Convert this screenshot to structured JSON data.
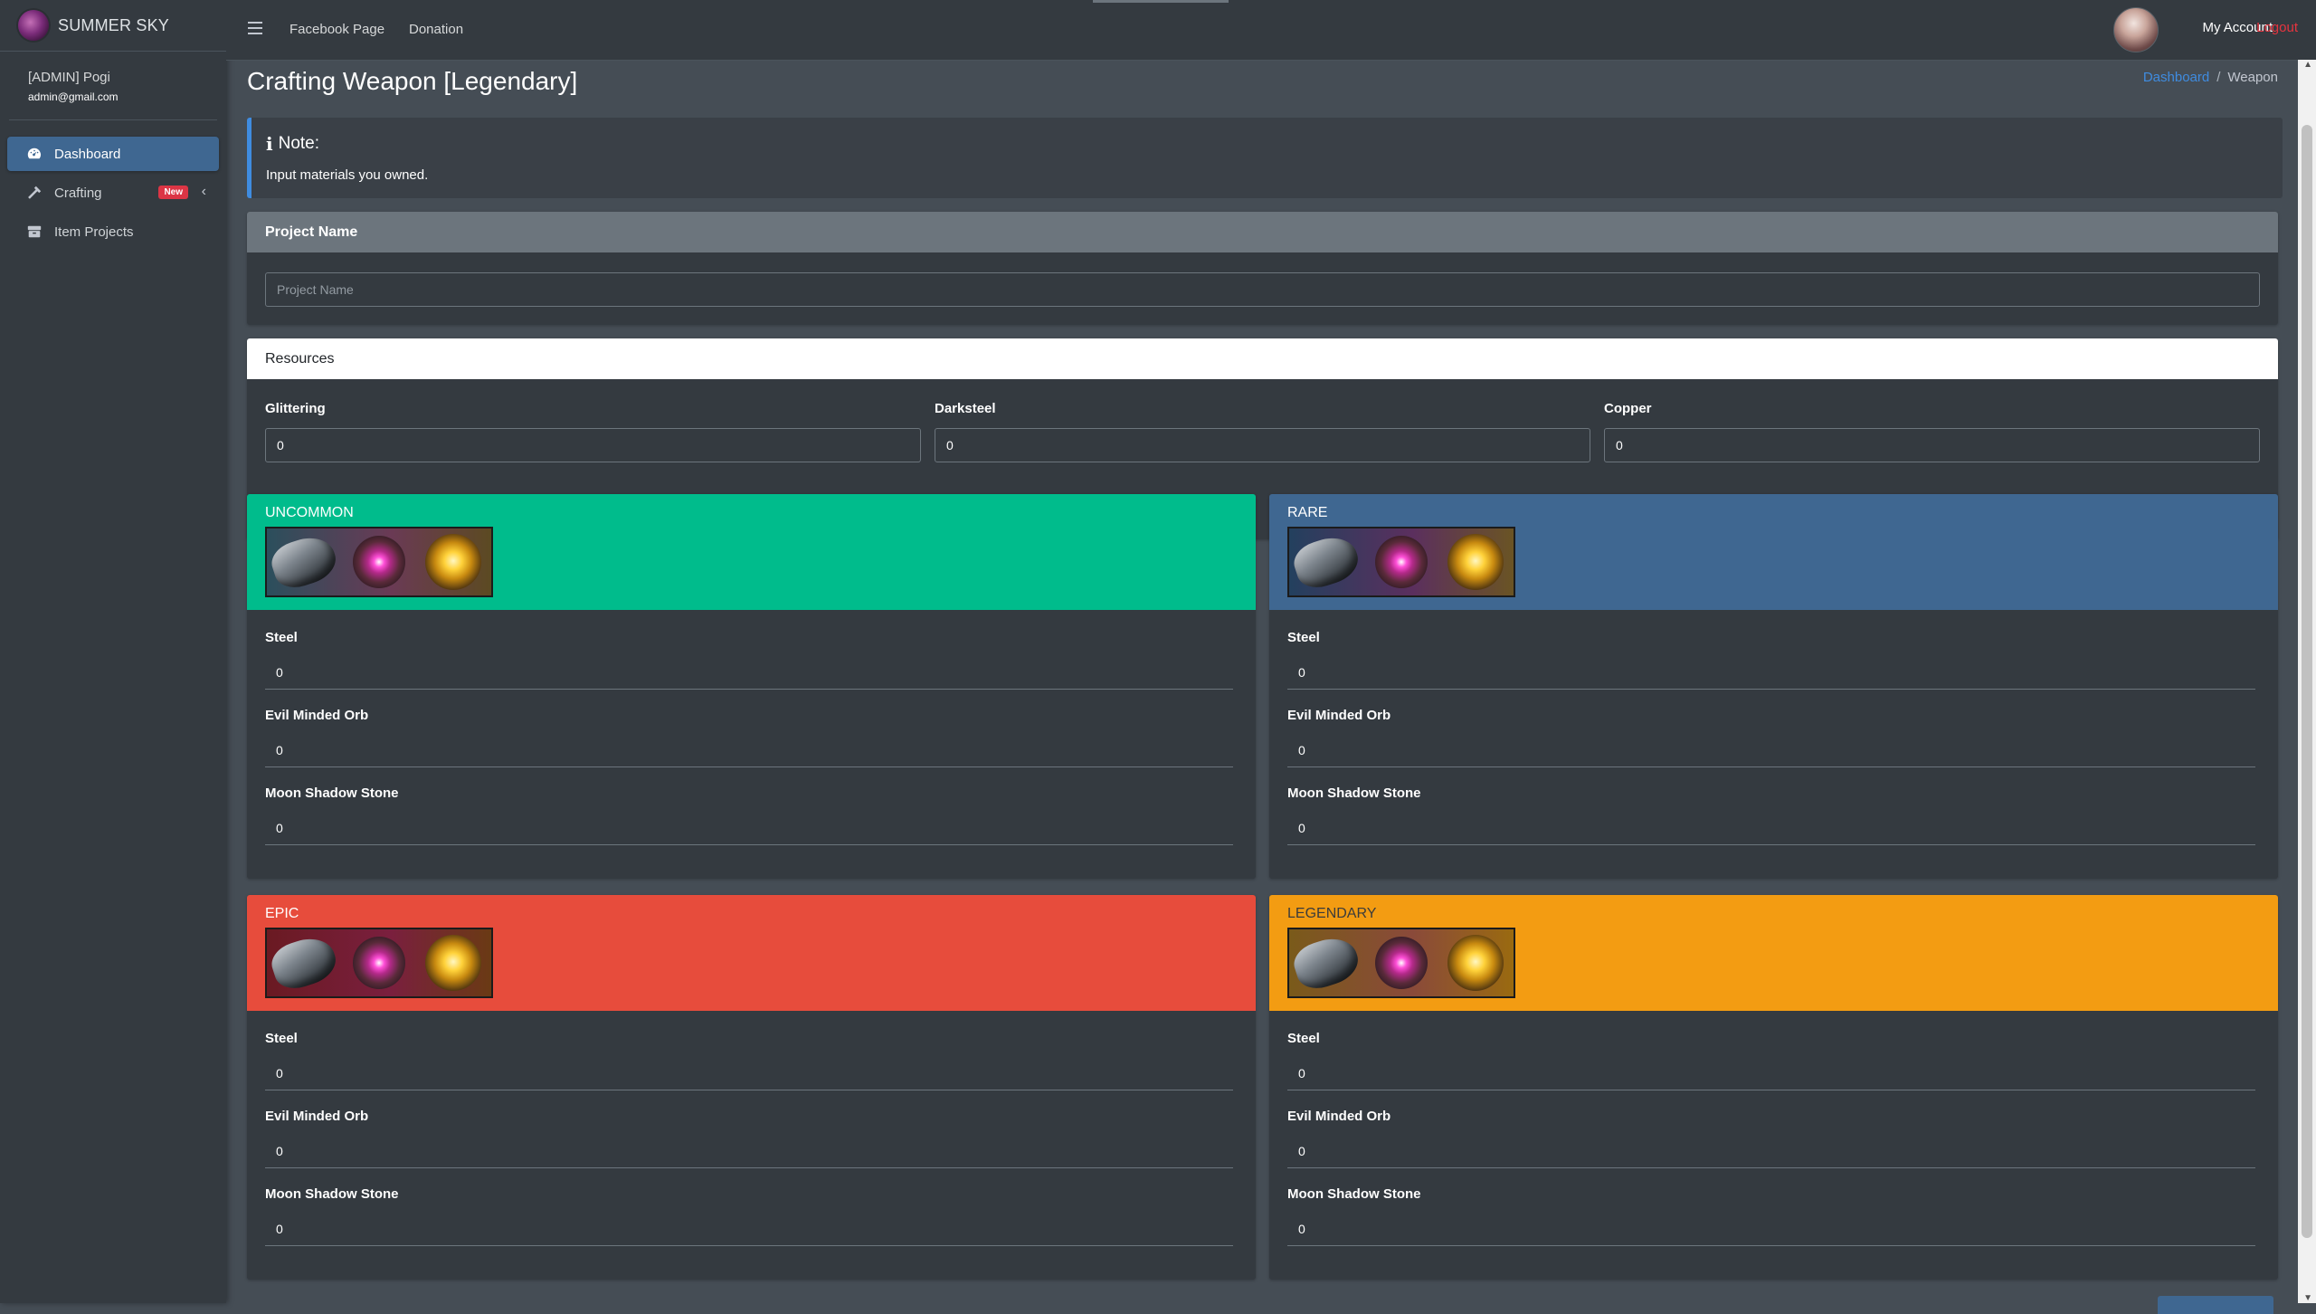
{
  "brand": {
    "name": "SUMMER SKY"
  },
  "user": {
    "name": "[ADMIN] Pogi",
    "email": "admin@gmail.com"
  },
  "sidebar": {
    "items": [
      {
        "label": "Dashboard",
        "icon": "tachometer-icon",
        "active": true
      },
      {
        "label": "Crafting",
        "icon": "hammer-icon",
        "badge": "New"
      },
      {
        "label": "Item Projects",
        "icon": "box-icon"
      }
    ]
  },
  "topbar": {
    "links": [
      "Facebook Page",
      "Donation"
    ],
    "account": "My Account",
    "logout": "Logout"
  },
  "page": {
    "title": "Crafting Weapon [Legendary]",
    "breadcrumb": {
      "home": "Dashboard",
      "separator": "/",
      "current": "Weapon"
    }
  },
  "note": {
    "title": "Note:",
    "text": "Input materials you owned."
  },
  "project": {
    "header": "Project Name",
    "placeholder": "Project Name",
    "value": ""
  },
  "resources": {
    "header": "Resources",
    "fields": [
      {
        "label": "Glittering",
        "value": "0"
      },
      {
        "label": "Darksteel",
        "value": "0"
      },
      {
        "label": "Copper",
        "value": "0"
      }
    ]
  },
  "tiers": [
    {
      "name": "UNCOMMON",
      "color": "#00bc8c",
      "materials": [
        {
          "label": "Steel",
          "value": "0"
        },
        {
          "label": "Evil Minded Orb",
          "value": "0"
        },
        {
          "label": "Moon Shadow Stone",
          "value": "0"
        }
      ]
    },
    {
      "name": "RARE",
      "color": "#3f6791",
      "materials": [
        {
          "label": "Steel",
          "value": "0"
        },
        {
          "label": "Evil Minded Orb",
          "value": "0"
        },
        {
          "label": "Moon Shadow Stone",
          "value": "0"
        }
      ]
    },
    {
      "name": "EPIC",
      "color": "#e74c3c",
      "materials": [
        {
          "label": "Steel",
          "value": "0"
        },
        {
          "label": "Evil Minded Orb",
          "value": "0"
        },
        {
          "label": "Moon Shadow Stone",
          "value": "0"
        }
      ]
    },
    {
      "name": "LEGENDARY",
      "color": "#f39c12",
      "materials": [
        {
          "label": "Steel",
          "value": "0"
        },
        {
          "label": "Evil Minded Orb",
          "value": "0"
        },
        {
          "label": "Moon Shadow Stone",
          "value": "0"
        }
      ]
    }
  ],
  "colors": {
    "sidebar_bg": "#343a40",
    "content_bg": "#454d55",
    "accent": "#3f6791",
    "link": "#3f8ce0",
    "danger": "#e7343f"
  }
}
